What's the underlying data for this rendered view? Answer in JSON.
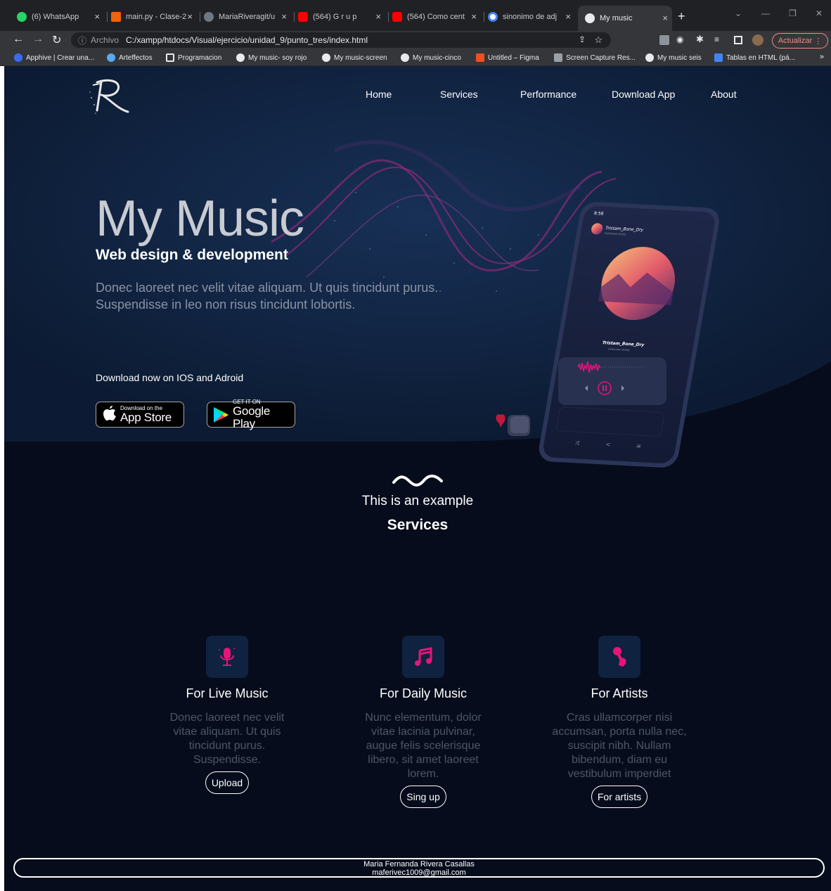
{
  "browser": {
    "tabs": [
      {
        "title": "(6) WhatsApp",
        "favicon": "whatsapp-icon",
        "color": "#25d366"
      },
      {
        "title": "main.py - Clase-2",
        "favicon": "replit-icon",
        "color": "#f26207"
      },
      {
        "title": "MariaRiveragit/u",
        "favicon": "github-icon",
        "color": "#6e7681"
      },
      {
        "title": "(564) G r u p",
        "favicon": "youtube-icon",
        "color": "#ff0000"
      },
      {
        "title": "(564) Como cent",
        "favicon": "youtube-icon",
        "color": "#ff0000"
      },
      {
        "title": "sinonimo de adj",
        "favicon": "google-icon",
        "color": "#4285f4"
      },
      {
        "title": "My music",
        "favicon": "globe-icon",
        "color": "#e8eaed",
        "active": true
      }
    ],
    "address": {
      "scheme_label": "Archivo",
      "url": "C:/xampp/htdocs/Visual/ejercicio/unidad_9/punto_tres/index.html"
    },
    "update_button": "Actualizar",
    "bookmarks": [
      {
        "label": "Apphive | Crear una...",
        "icon": "apphive-icon",
        "color": "#3b6bf2"
      },
      {
        "label": "Arteffectos",
        "icon": "chat-icon",
        "color": "#5aa9f0"
      },
      {
        "label": "Programacion",
        "icon": "folder-grid-icon",
        "color": "#e8eaed"
      },
      {
        "label": "My music- soy rojo",
        "icon": "globe-icon",
        "color": "#e8eaed"
      },
      {
        "label": "My music-screen",
        "icon": "globe-icon",
        "color": "#e8eaed"
      },
      {
        "label": "My music-cinco",
        "icon": "globe-icon",
        "color": "#e8eaed"
      },
      {
        "label": "Untitled – Figma",
        "icon": "figma-icon",
        "color": "#f24e1e"
      },
      {
        "label": "Screen Capture Res...",
        "icon": "camera-icon",
        "color": "#9aa0a6"
      },
      {
        "label": "My music seis",
        "icon": "globe-icon",
        "color": "#e8eaed"
      },
      {
        "label": "Tablas en HTML (pá...",
        "icon": "doc-icon",
        "color": "#4285f4"
      }
    ],
    "bookmarks_more": "»"
  },
  "site": {
    "nav": [
      "Home",
      "Services",
      "Performance",
      "Download App",
      "About"
    ],
    "hero": {
      "title": "My Music",
      "subtitle": "Web design & development",
      "description": "Donec laoreet nec velit vitae aliquam. Ut quis tincidunt purus. Suspendisse in leo non risus tincidunt lobortis.",
      "download_text": "Download now on IOS and Adroid",
      "app_store": {
        "small": "Download on the",
        "big": "App Store"
      },
      "google_play": {
        "small": "GET IT ON",
        "big": "Google Play"
      },
      "phone": {
        "time": "8:58",
        "track_header": "Tristam_Bone_Dry",
        "artist_header": "Unknown Artist",
        "track": "Tristam_Bone_Dry",
        "artist": "Unknown Artist"
      }
    },
    "services": {
      "kicker": "This is an example",
      "title": "Services",
      "cards": [
        {
          "title": "For Live Music",
          "text": "Donec laoreet nec velit vitae aliquam. Ut quis tincidunt purus. Suspendisse.",
          "button": "Upload",
          "icon": "microphone-icon"
        },
        {
          "title": "For Daily Music",
          "text": "Nunc elementum, dolor vitae lacinia pulvinar, augue felis scelerisque libero, sit amet laoreet lorem.",
          "button": "Sing up",
          "icon": "music-notes-icon"
        },
        {
          "title": "For Artists",
          "text": "Cras ullamcorper nisi accumsan, porta nulla nec, suscipit nibh. Nullam bibendum, diam eu vestibulum imperdiet",
          "button": "For artists",
          "icon": "hand-microphone-icon"
        }
      ]
    },
    "footer": {
      "name": "Maria Fernanda Rivera Casallas",
      "email": "maferivec1009@gmail.com"
    },
    "colors": {
      "hero_bg": "#0c1b33",
      "page_bg": "#060c1b",
      "accent_pink": "#e6157a",
      "wave": "#9b2a7a"
    }
  }
}
